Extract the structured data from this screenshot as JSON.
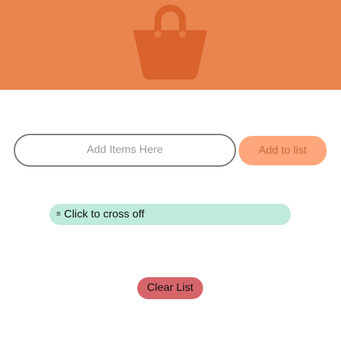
{
  "header": {
    "icon": "shopping-bag-icon",
    "background_color": "#EB8550",
    "icon_color": "#D9632B"
  },
  "input": {
    "placeholder": "Add Items Here",
    "value": ""
  },
  "add_button": {
    "label": "Add to list",
    "color": "#FFA77C"
  },
  "list": {
    "items": [
      {
        "handle": "≡",
        "label": "Click to cross off",
        "color": "#BFEBDC"
      }
    ]
  },
  "clear_button": {
    "label": "Clear List",
    "color": "#D6656B"
  }
}
